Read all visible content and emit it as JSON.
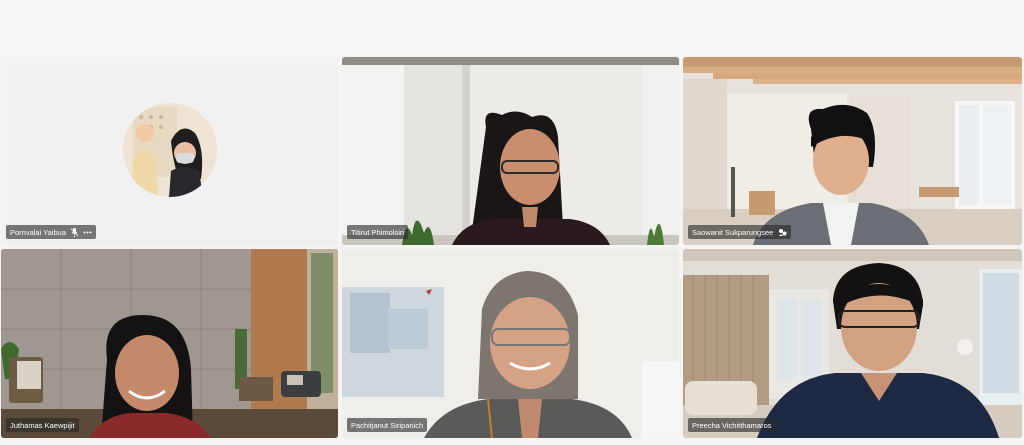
{
  "participants": [
    {
      "name": "Pornvalai Yaibua",
      "video": false,
      "muted": true,
      "more_icon": "more-options-icon"
    },
    {
      "name": "Titirut Phimolsiri",
      "video": true
    },
    {
      "name": "Saowanit Sukparungsee",
      "video": true,
      "status_icon": "pin-icon"
    },
    {
      "name": "Juthamas Kaewpijit",
      "video": true,
      "active_speaker": true
    },
    {
      "name": "Pachitjanut Siripanich",
      "video": true
    },
    {
      "name": "Preecha Vichitthamaros",
      "video": true
    }
  ],
  "colors": {
    "active_speaker_border": "#7f84d6",
    "name_tag_bg": "#3a3a3a",
    "page_bg": "#f4f4f4"
  }
}
